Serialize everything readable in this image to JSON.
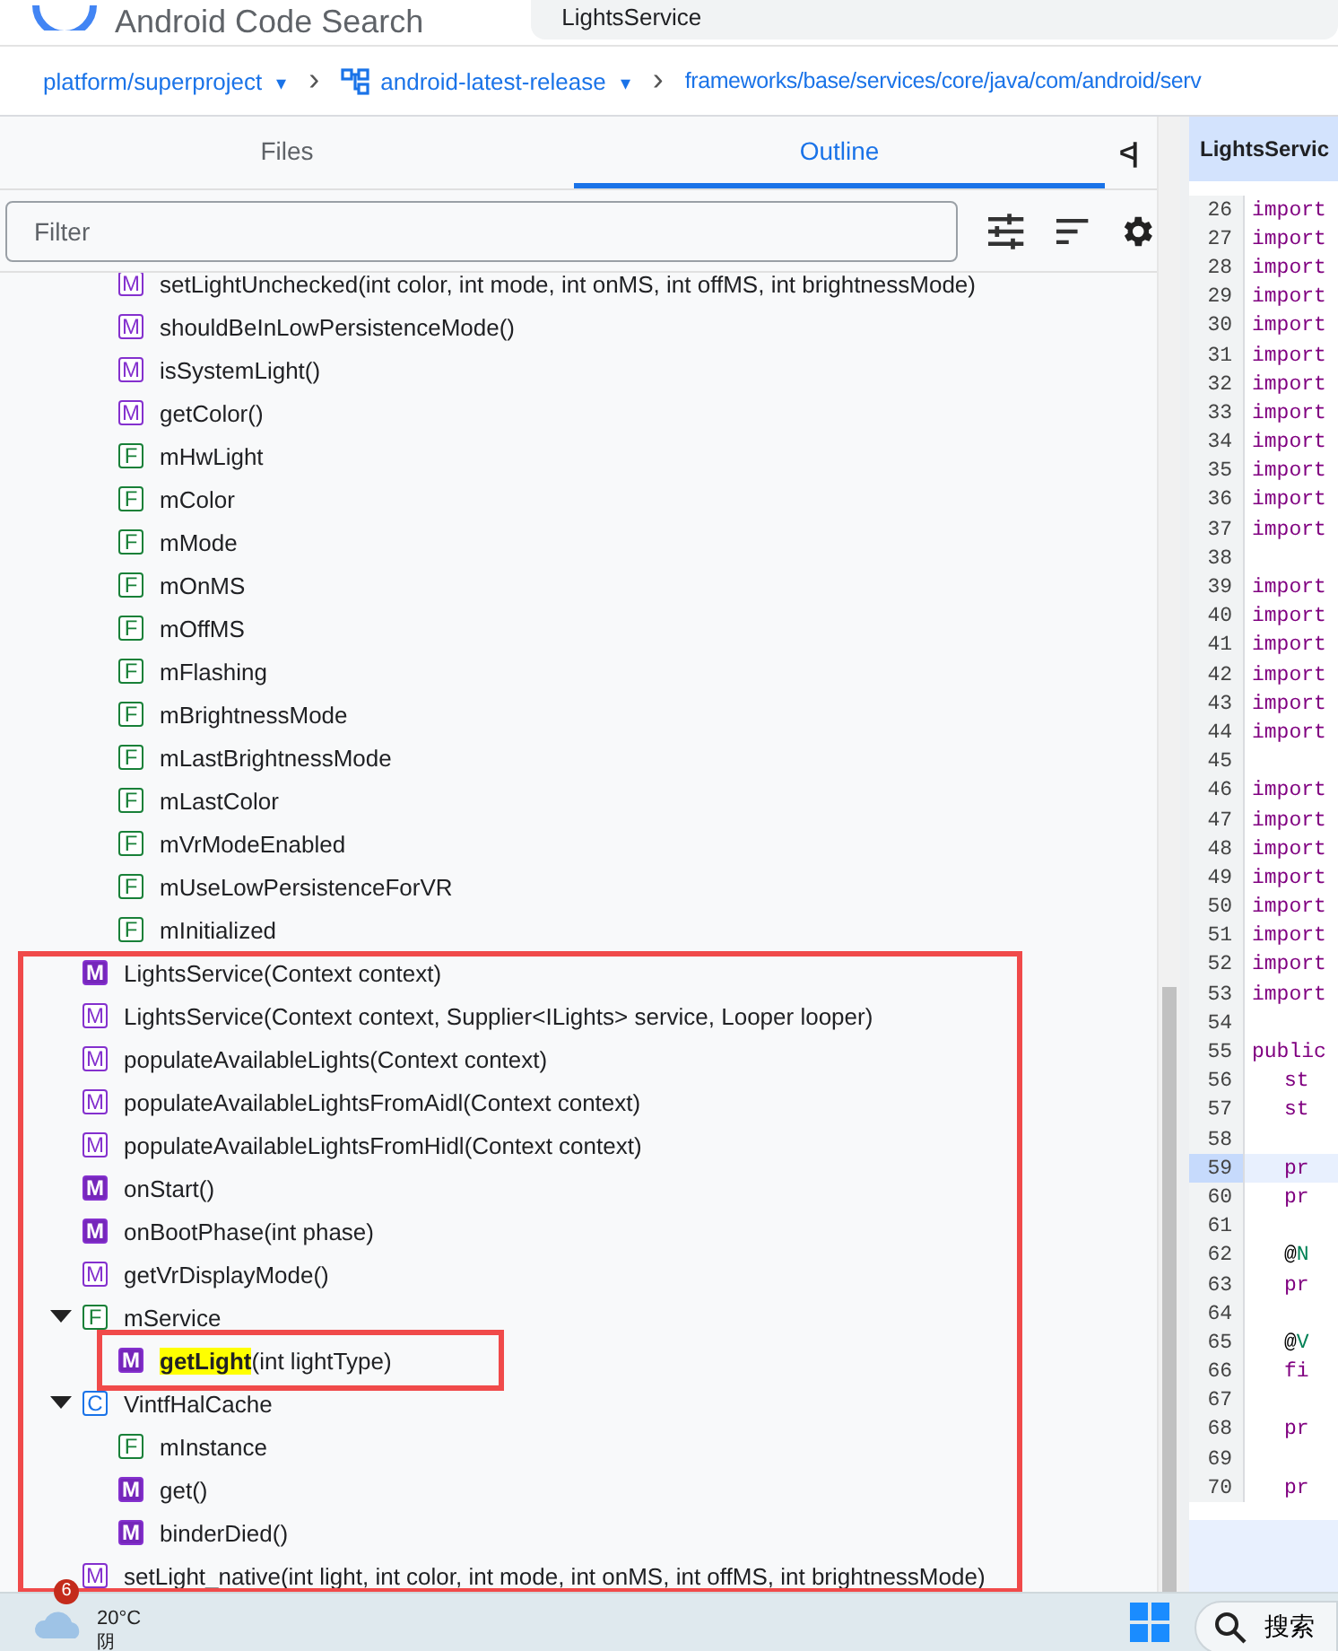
{
  "header": {
    "app_title": "Android Code Search",
    "search_value": "LightsService"
  },
  "breadcrumb": [
    {
      "kind": "dropdown",
      "label": "platform/superproject",
      "caret": "▾"
    },
    {
      "kind": "branch",
      "label": "android-latest-release",
      "caret": "▾"
    },
    {
      "kind": "path",
      "label": "frameworks/base/services/core/java/com/android/serv"
    }
  ],
  "breadcrumb_separator": "›",
  "tabs": [
    {
      "label": "Files",
      "selected": false
    },
    {
      "label": "Outline",
      "selected": true
    }
  ],
  "collapse_label": "<|",
  "filter": {
    "placeholder": "Filter"
  },
  "outline": {
    "continued_children": [
      {
        "badge": "M",
        "filled": false,
        "label": "setLightUnchecked(int color, int mode, int onMS, int offMS, int brightnessMode)"
      },
      {
        "badge": "M",
        "filled": false,
        "label": "shouldBeInLowPersistenceMode()"
      },
      {
        "badge": "M",
        "filled": false,
        "label": "isSystemLight()"
      },
      {
        "badge": "M",
        "filled": false,
        "label": "getColor()"
      },
      {
        "badge": "F",
        "filled": false,
        "label": "mHwLight"
      },
      {
        "badge": "F",
        "filled": false,
        "label": "mColor"
      },
      {
        "badge": "F",
        "filled": false,
        "label": "mMode"
      },
      {
        "badge": "F",
        "filled": false,
        "label": "mOnMS"
      },
      {
        "badge": "F",
        "filled": false,
        "label": "mOffMS"
      },
      {
        "badge": "F",
        "filled": false,
        "label": "mFlashing"
      },
      {
        "badge": "F",
        "filled": false,
        "label": "mBrightnessMode"
      },
      {
        "badge": "F",
        "filled": false,
        "label": "mLastBrightnessMode"
      },
      {
        "badge": "F",
        "filled": false,
        "label": "mLastColor"
      },
      {
        "badge": "F",
        "filled": false,
        "label": "mVrModeEnabled"
      },
      {
        "badge": "F",
        "filled": false,
        "label": "mUseLowPersistenceForVR"
      },
      {
        "badge": "F",
        "filled": false,
        "label": "mInitialized"
      }
    ],
    "items": [
      {
        "badge": "M",
        "filled": true,
        "label": "LightsService(Context context)"
      },
      {
        "badge": "M",
        "filled": false,
        "label": "LightsService(Context context, Supplier<ILights> service, Looper looper)"
      },
      {
        "badge": "M",
        "filled": false,
        "label": "populateAvailableLights(Context context)"
      },
      {
        "badge": "M",
        "filled": false,
        "label": "populateAvailableLightsFromAidl(Context context)"
      },
      {
        "badge": "M",
        "filled": false,
        "label": "populateAvailableLightsFromHidl(Context context)"
      },
      {
        "badge": "M",
        "filled": true,
        "label": "onStart()"
      },
      {
        "badge": "M",
        "filled": true,
        "label": "onBootPhase(int phase)"
      },
      {
        "badge": "M",
        "filled": false,
        "label": "getVrDisplayMode()"
      },
      {
        "badge": "F",
        "filled": false,
        "label": "mService",
        "expanded": true,
        "children": [
          {
            "badge": "M",
            "filled": true,
            "match": "getLight",
            "label": "(int lightType)"
          }
        ]
      },
      {
        "badge": "C",
        "filled": false,
        "label": "VintfHalCache",
        "expanded": true,
        "children": [
          {
            "badge": "F",
            "filled": false,
            "label": "mInstance"
          },
          {
            "badge": "M",
            "filled": true,
            "label": "get()"
          },
          {
            "badge": "M",
            "filled": true,
            "label": "binderDied()"
          }
        ]
      },
      {
        "badge": "M",
        "filled": false,
        "label": "setLight_native(int light, int color, int mode, int onMS, int offMS, int brightnessMode)"
      }
    ]
  },
  "code": {
    "file_tab": "LightsServic",
    "lines": [
      {
        "number": "26",
        "selected": false,
        "parts": [
          {
            "kind": "keyword",
            "text": "import"
          }
        ]
      },
      {
        "number": "27",
        "selected": false,
        "parts": [
          {
            "kind": "keyword",
            "text": "import"
          }
        ]
      },
      {
        "number": "28",
        "selected": false,
        "parts": [
          {
            "kind": "keyword",
            "text": "import"
          }
        ]
      },
      {
        "number": "29",
        "selected": false,
        "parts": [
          {
            "kind": "keyword",
            "text": "import"
          }
        ]
      },
      {
        "number": "30",
        "selected": false,
        "parts": [
          {
            "kind": "keyword",
            "text": "import"
          }
        ]
      },
      {
        "number": "31",
        "selected": false,
        "parts": [
          {
            "kind": "keyword",
            "text": "import"
          }
        ]
      },
      {
        "number": "32",
        "selected": false,
        "parts": [
          {
            "kind": "keyword",
            "text": "import"
          }
        ]
      },
      {
        "number": "33",
        "selected": false,
        "parts": [
          {
            "kind": "keyword",
            "text": "import"
          }
        ]
      },
      {
        "number": "34",
        "selected": false,
        "parts": [
          {
            "kind": "keyword",
            "text": "import"
          }
        ]
      },
      {
        "number": "35",
        "selected": false,
        "parts": [
          {
            "kind": "keyword",
            "text": "import"
          }
        ]
      },
      {
        "number": "36",
        "selected": false,
        "parts": [
          {
            "kind": "keyword",
            "text": "import"
          }
        ]
      },
      {
        "number": "37",
        "selected": false,
        "parts": [
          {
            "kind": "keyword",
            "text": "import"
          }
        ]
      },
      {
        "number": "38",
        "selected": false
      },
      {
        "number": "39",
        "selected": false,
        "parts": [
          {
            "kind": "keyword",
            "text": "import"
          }
        ]
      },
      {
        "number": "40",
        "selected": false,
        "parts": [
          {
            "kind": "keyword",
            "text": "import"
          }
        ]
      },
      {
        "number": "41",
        "selected": false,
        "parts": [
          {
            "kind": "keyword",
            "text": "import"
          }
        ]
      },
      {
        "number": "42",
        "selected": false,
        "parts": [
          {
            "kind": "keyword",
            "text": "import"
          }
        ]
      },
      {
        "number": "43",
        "selected": false,
        "parts": [
          {
            "kind": "keyword",
            "text": "import"
          }
        ]
      },
      {
        "number": "44",
        "selected": false,
        "parts": [
          {
            "kind": "keyword",
            "text": "import"
          }
        ]
      },
      {
        "number": "45",
        "selected": false
      },
      {
        "number": "46",
        "selected": false,
        "parts": [
          {
            "kind": "keyword",
            "text": "import"
          }
        ]
      },
      {
        "number": "47",
        "selected": false,
        "parts": [
          {
            "kind": "keyword",
            "text": "import"
          }
        ]
      },
      {
        "number": "48",
        "selected": false,
        "parts": [
          {
            "kind": "keyword",
            "text": "import"
          }
        ]
      },
      {
        "number": "49",
        "selected": false,
        "parts": [
          {
            "kind": "keyword",
            "text": "import"
          }
        ]
      },
      {
        "number": "50",
        "selected": false,
        "parts": [
          {
            "kind": "keyword",
            "text": "import"
          }
        ]
      },
      {
        "number": "51",
        "selected": false,
        "parts": [
          {
            "kind": "keyword",
            "text": "import"
          }
        ]
      },
      {
        "number": "52",
        "selected": false,
        "parts": [
          {
            "kind": "keyword",
            "text": "import"
          }
        ]
      },
      {
        "number": "53",
        "selected": false,
        "parts": [
          {
            "kind": "keyword",
            "text": "import"
          }
        ]
      },
      {
        "number": "54",
        "selected": false
      },
      {
        "number": "55",
        "selected": false,
        "parts": [
          {
            "kind": "keyword",
            "text": "public"
          }
        ]
      },
      {
        "number": "56",
        "selected": false,
        "indented": true,
        "parts": [
          {
            "kind": "keyword",
            "text": "st"
          }
        ]
      },
      {
        "number": "57",
        "selected": false,
        "indented": true,
        "parts": [
          {
            "kind": "keyword",
            "text": "st"
          }
        ]
      },
      {
        "number": "58",
        "selected": false
      },
      {
        "number": "59",
        "selected": true,
        "indented": true,
        "parts": [
          {
            "kind": "keyword",
            "text": "pr"
          }
        ]
      },
      {
        "number": "60",
        "selected": false,
        "indented": true,
        "parts": [
          {
            "kind": "keyword",
            "text": "pr"
          }
        ]
      },
      {
        "number": "61",
        "selected": false
      },
      {
        "number": "62",
        "selected": false,
        "indented": true,
        "parts": [
          {
            "kind": "plain",
            "text": "@"
          },
          {
            "kind": "annotation",
            "text": "N"
          }
        ]
      },
      {
        "number": "63",
        "selected": false,
        "indented": true,
        "parts": [
          {
            "kind": "keyword",
            "text": "pr"
          }
        ]
      },
      {
        "number": "64",
        "selected": false
      },
      {
        "number": "65",
        "selected": false,
        "indented": true,
        "parts": [
          {
            "kind": "plain",
            "text": "@"
          },
          {
            "kind": "annotation",
            "text": "V"
          }
        ]
      },
      {
        "number": "66",
        "selected": false,
        "indented": true,
        "parts": [
          {
            "kind": "keyword",
            "text": "fi"
          }
        ]
      },
      {
        "number": "67",
        "selected": false
      },
      {
        "number": "68",
        "selected": false,
        "indented": true,
        "parts": [
          {
            "kind": "keyword",
            "text": "pr"
          }
        ]
      },
      {
        "number": "69",
        "selected": false
      },
      {
        "number": "70",
        "selected": false,
        "indented": true,
        "parts": [
          {
            "kind": "keyword",
            "text": "pr"
          }
        ]
      }
    ]
  },
  "taskbar": {
    "notification_count": "6",
    "temperature": "20°C",
    "weather": "阴",
    "search_label": "搜索"
  }
}
